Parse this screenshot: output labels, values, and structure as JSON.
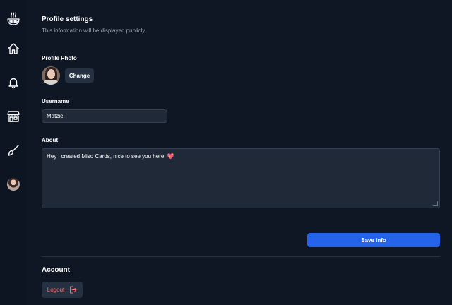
{
  "sidebar": {
    "logo_text": "miso",
    "items": [
      {
        "name": "home",
        "icon": "home-icon"
      },
      {
        "name": "notifications",
        "icon": "bell-icon"
      },
      {
        "name": "store",
        "icon": "store-icon"
      },
      {
        "name": "paint",
        "icon": "paintbrush-icon"
      },
      {
        "name": "profile",
        "icon": "avatar"
      }
    ]
  },
  "profile": {
    "title": "Profile settings",
    "subtitle": "This information will be displayed publicly.",
    "photo_label": "Profile Photo",
    "change_label": "Change",
    "username_label": "Username",
    "username_value": "Matzie",
    "about_label": "About",
    "about_value": "Hey i created Miso Cards, nice to see you here! 💖",
    "save_label": "Save info"
  },
  "account": {
    "title": "Account",
    "logout_label": "Logout"
  },
  "colors": {
    "background": "#0f1624",
    "input_bg": "#1f2937",
    "button_bg": "#253041",
    "primary": "#2563eb",
    "danger": "#f87171"
  }
}
